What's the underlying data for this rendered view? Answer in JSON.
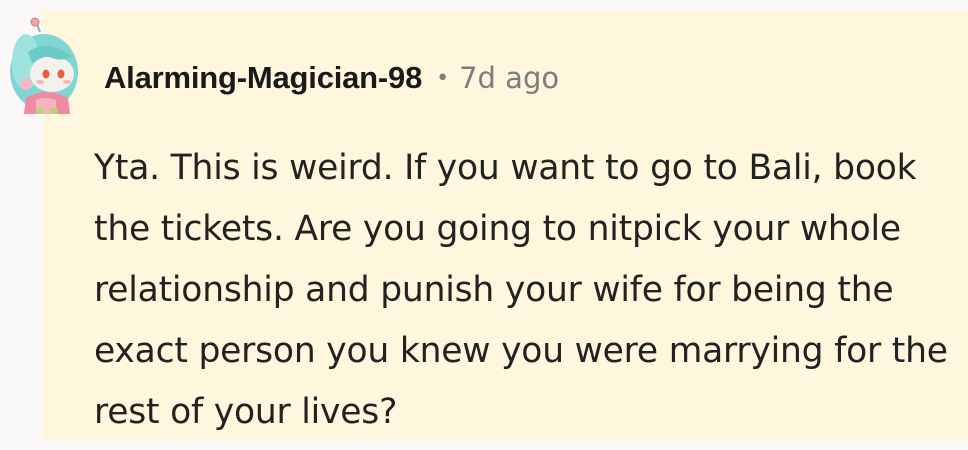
{
  "comment": {
    "username": "Alarming-Magician-98",
    "separator": "•",
    "timestamp": "7d ago",
    "body": "Yta. This is weird. If you want to go to Bali, book the tickets. Are you going to nitpick your whole relationship and punish your wife for being the exact person you knew you were marrying for the rest of your lives?"
  },
  "avatar": {
    "icon": "snoo-avatar-icon",
    "hair_color": "#7fd6d3",
    "face_color": "#f3f0ee",
    "shirt_color": "#f08aa0"
  },
  "colors": {
    "page_background": "#fbf9f7",
    "card_background": "#fef7dd",
    "username_text": "#1a1a1b",
    "meta_text": "#7c7c7c",
    "body_text": "#222222"
  }
}
